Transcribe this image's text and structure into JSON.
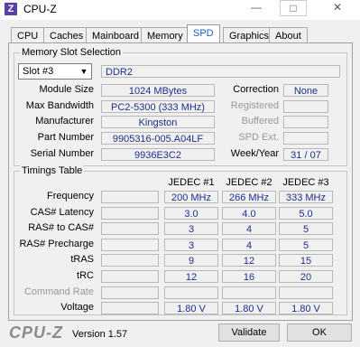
{
  "app": {
    "title": "CPU-Z",
    "icon": "Z",
    "minimize": "—",
    "maximize": "□",
    "close": "✕"
  },
  "tabs": [
    "CPU",
    "Caches",
    "Mainboard",
    "Memory",
    "SPD",
    "Graphics",
    "About"
  ],
  "active_tab": "SPD",
  "memory_slot": {
    "group_label": "Memory Slot Selection",
    "slot_value": "Slot #3",
    "type": "DDR2",
    "labels": {
      "module_size": "Module Size",
      "max_bandwidth": "Max Bandwidth",
      "manufacturer": "Manufacturer",
      "part_number": "Part Number",
      "serial_number": "Serial Number",
      "correction": "Correction",
      "registered": "Registered",
      "buffered": "Buffered",
      "spd_ext": "SPD Ext.",
      "week_year": "Week/Year"
    },
    "values": {
      "module_size": "1024 MBytes",
      "max_bandwidth": "PC2-5300 (333 MHz)",
      "manufacturer": "Kingston",
      "part_number": "9905316-005.A04LF",
      "serial_number": "9936E3C2",
      "correction": "None",
      "registered": "",
      "buffered": "",
      "spd_ext": "",
      "week_year": "31 / 07"
    }
  },
  "timings": {
    "group_label": "Timings Table",
    "columns": [
      "JEDEC #1",
      "JEDEC #2",
      "JEDEC #3"
    ],
    "rows": [
      {
        "label": "Frequency",
        "values": [
          "200 MHz",
          "266 MHz",
          "333 MHz"
        ],
        "grayed": false
      },
      {
        "label": "CAS# Latency",
        "values": [
          "3.0",
          "4.0",
          "5.0"
        ],
        "grayed": false
      },
      {
        "label": "RAS# to CAS#",
        "values": [
          "3",
          "4",
          "5"
        ],
        "grayed": false
      },
      {
        "label": "RAS# Precharge",
        "values": [
          "3",
          "4",
          "5"
        ],
        "grayed": false
      },
      {
        "label": "tRAS",
        "values": [
          "9",
          "12",
          "15"
        ],
        "grayed": false
      },
      {
        "label": "tRC",
        "values": [
          "12",
          "16",
          "20"
        ],
        "grayed": false
      },
      {
        "label": "Command Rate",
        "values": [
          "",
          "",
          ""
        ],
        "grayed": true
      },
      {
        "label": "Voltage",
        "values": [
          "1.80 V",
          "1.80 V",
          "1.80 V"
        ],
        "grayed": false
      }
    ]
  },
  "footer": {
    "logo": "CPU-Z",
    "version": "Version 1.57",
    "validate_label": "Validate",
    "ok_label": "OK"
  }
}
